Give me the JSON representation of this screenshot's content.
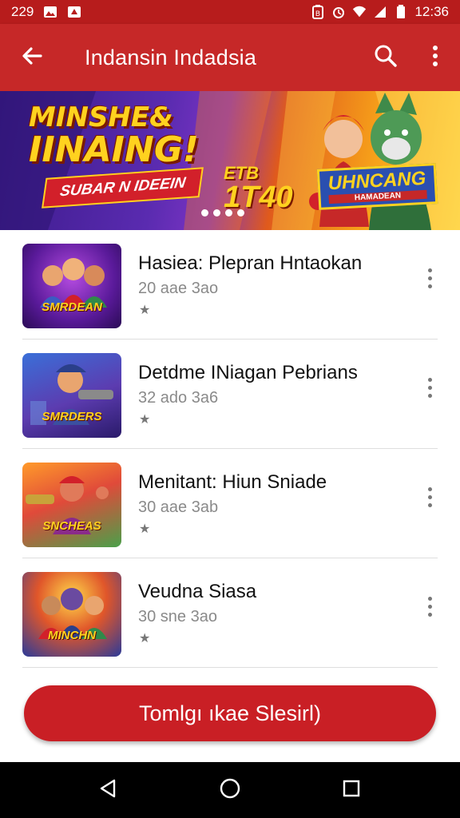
{
  "status_bar": {
    "time_left": "229",
    "time_right": "12:36",
    "icons": [
      "photo-icon",
      "notification-icon",
      "battery-saver-icon",
      "alarm-icon",
      "wifi-icon",
      "signal-icon",
      "battery-icon"
    ]
  },
  "app_bar": {
    "title": "Indansin Indadsia",
    "back_icon": "arrow-back-icon",
    "search_icon": "search-icon",
    "menu_icon": "more-vert-icon"
  },
  "banner": {
    "title_line1": "MINSHE&",
    "title_line2": "IINAING!",
    "ribbon": "SUBAR N IDEEIN",
    "number": "1T40",
    "number_small": "ETB",
    "tag_main": "UHNCANG",
    "tag_sub": "HAMADEAN",
    "page_count": 4,
    "active_page": 1
  },
  "list": {
    "items": [
      {
        "title": "Hasiea: Plepran Hntaokan",
        "meta": "20 aae 3ao",
        "star": "★",
        "thumb_label": "SMRDEAN"
      },
      {
        "title": "Detdme INiagan Pebrians",
        "meta": "32 ado 3a6",
        "star": "★",
        "thumb_label": "SMRDERS"
      },
      {
        "title": "Menitant: Hiun Sniade",
        "meta": "30 aae 3ab",
        "star": "★",
        "thumb_label": "SNCHEAS"
      },
      {
        "title": "Veudna Siasa",
        "meta": "30 sne 3ao",
        "star": "★",
        "thumb_label": "MINCHN"
      }
    ]
  },
  "cta": {
    "label": "Tomlgı ıkae Slesirl)"
  },
  "colors": {
    "primary": "#c62828",
    "status": "#b71c1c",
    "cta": "#c91f25"
  }
}
